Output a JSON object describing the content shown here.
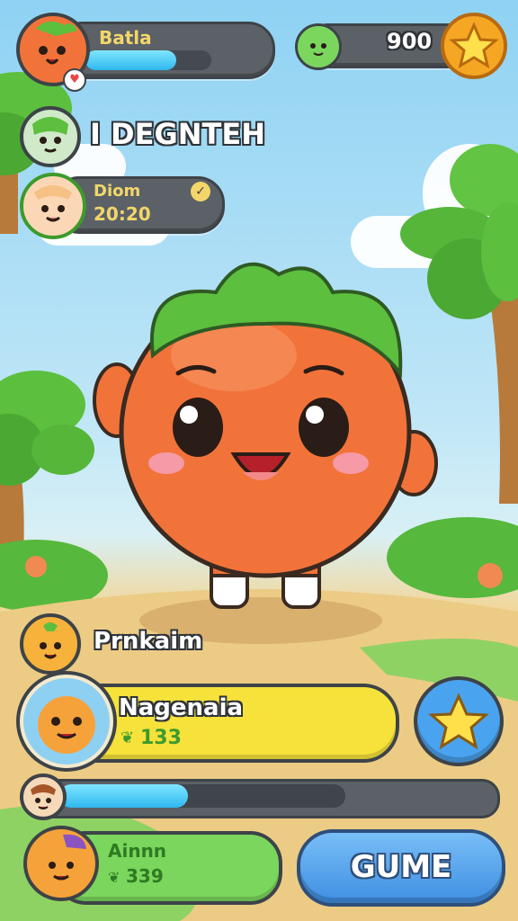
{
  "player": {
    "name": "Batla",
    "xp_fraction": 0.72
  },
  "currency": {
    "amount": "900"
  },
  "title": "I DEGNTEH",
  "rival": {
    "name": "Diom",
    "time": "20:20"
  },
  "bottom": {
    "label1": "Prnkaim",
    "card_name": "Nagenaia",
    "card_value": "133",
    "progress_fraction": 0.45,
    "card2_name": "Ainnn",
    "card2_value": "339",
    "game_button": "GUME"
  },
  "colors": {
    "accent_blue": "#2fb8ef",
    "yellow_panel": "#f6e23a",
    "green_panel": "#7bd65d",
    "button_blue": "#4aa3ee",
    "character_orange": "#f2733a"
  },
  "icons": [
    "star-icon",
    "leaf-icon",
    "heart-icon",
    "check-icon",
    "green-blob-icon"
  ]
}
